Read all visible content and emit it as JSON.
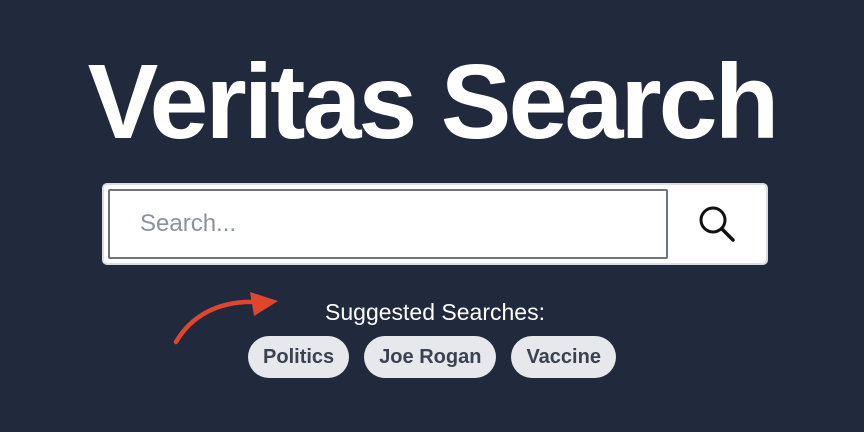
{
  "app": {
    "title": "Veritas Search"
  },
  "search": {
    "placeholder": "Search...",
    "value": "",
    "button_icon": "search-icon"
  },
  "suggestions": {
    "label": "Suggested Searches:",
    "arrow_icon": "curved-arrow-icon",
    "arrow_color": "#e0452d",
    "items": [
      "Politics",
      "Joe Rogan",
      "Vaccine"
    ]
  },
  "colors": {
    "background": "#212a3d",
    "chip_background": "#e7e8ec",
    "chip_text": "#3a4150"
  }
}
